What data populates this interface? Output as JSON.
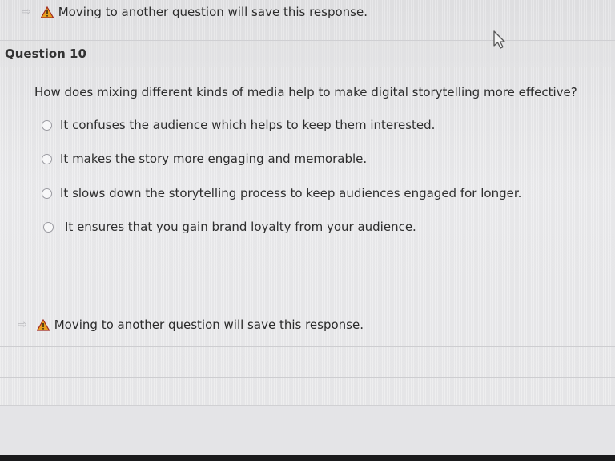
{
  "notice_top": {
    "text": "Moving to another question will save this response."
  },
  "question": {
    "title": "Question 10",
    "prompt": "How does mixing different kinds of media help to make digital storytelling more effective?",
    "options": [
      "It confuses the audience which helps to keep them interested.",
      "It makes the story more engaging and memorable.",
      "It slows down the storytelling process to keep audiences engaged for longer.",
      "It ensures that you gain brand loyalty from your audience."
    ]
  },
  "notice_bottom": {
    "text": "Moving to another question will save this response."
  },
  "icons": {
    "notice_arrow": "arrow-right-icon",
    "warning": "warning-icon",
    "cursor": "mouse-cursor-icon"
  },
  "colors": {
    "warning_fill": "#e8a020",
    "warning_stroke": "#a0281e"
  }
}
